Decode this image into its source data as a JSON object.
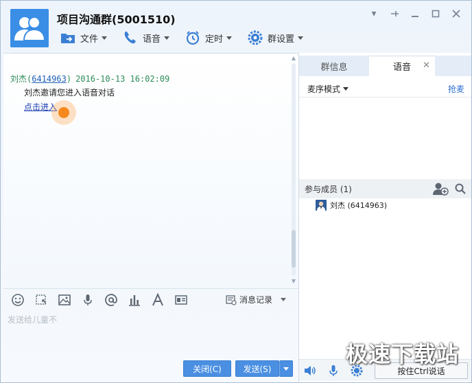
{
  "header": {
    "title": "项目沟通群(5001510)",
    "toolbar": [
      {
        "label": "文件",
        "icon": "folder-share-icon"
      },
      {
        "label": "语音",
        "icon": "phone-icon"
      },
      {
        "label": "定时",
        "icon": "alarm-clock-icon"
      },
      {
        "label": "群设置",
        "icon": "gear-icon"
      }
    ]
  },
  "chat": {
    "message": {
      "sender": "刘杰",
      "sender_id": "6414963",
      "timestamp": "2016-10-13 16:02:09",
      "body": "刘杰邀请您进入语音对话",
      "link": "点击进入"
    }
  },
  "input": {
    "placeholder": "发送给儿童不",
    "history_label": "消息记录",
    "close_label": "关闭(C)",
    "send_label": "发送(S)"
  },
  "right_panel": {
    "tabs": [
      {
        "label": "群信息"
      },
      {
        "label": "语音",
        "close": "✕"
      }
    ],
    "mode_label": "麦序模式",
    "grab_label": "抢麦",
    "members_label": "参与成员 (1)",
    "members": [
      {
        "name": "刘杰",
        "id": "(6414963)"
      }
    ],
    "talk_label": "按住Ctrl说话"
  },
  "watermark": "极速下载站",
  "colors": {
    "accent": "#4a8fe2",
    "link": "#1b3fb3",
    "sender": "#2b8c57",
    "click_marker": "#f5891f"
  }
}
